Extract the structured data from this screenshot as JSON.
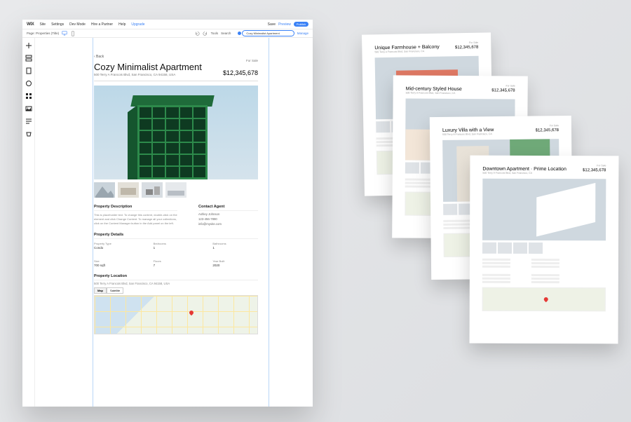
{
  "topbar": {
    "logo": "WIX",
    "menu": [
      "Site",
      "Settings",
      "Dev Mode",
      "Hire a Partner",
      "Help",
      "Upgrade"
    ],
    "right": {
      "save": "Save",
      "preview": "Preview",
      "publish": "Publish"
    }
  },
  "subbar": {
    "page_label": "Page: Properties (Title)",
    "tools": "Tools",
    "search": "Search",
    "chip": "Cozy Minimalist Apartment",
    "manage": "Manage"
  },
  "side_tools": [
    "add",
    "sections",
    "pages",
    "design",
    "apps",
    "media",
    "content",
    "store"
  ],
  "page": {
    "back": "‹ Back",
    "status": "For Sale",
    "title": "Cozy Minimalist Apartment",
    "address": "500 Terry A Francois Blvd, San Francisco, CA 94158, USA",
    "price": "$12,345,678",
    "thumbs_count": 4,
    "description": {
      "heading": "Property Description",
      "body": "This is placeholder text. To change this content, double-click on the element and click Change Content. To manage all your collections, click on the Content Manager button in the Add panel on the left."
    },
    "agent": {
      "heading": "Contact Agent",
      "name": "Ashley Johnson",
      "phone": "123-456-7890",
      "email": "info@mysite.com"
    },
    "details": {
      "heading": "Property Details",
      "items": [
        {
          "label": "Property Type",
          "value": "Condo"
        },
        {
          "label": "Bedrooms",
          "value": "1"
        },
        {
          "label": "Bathrooms",
          "value": "1"
        },
        {
          "label": "Size",
          "value": "700 sqft"
        },
        {
          "label": "Floors",
          "value": "7"
        },
        {
          "label": "Year Built",
          "value": "2020"
        }
      ]
    },
    "location": {
      "heading": "Property Location",
      "address": "500 Terry A Francois Blvd, San Francisco, CA 94158, USA",
      "controls": [
        "Map",
        "Satellite"
      ]
    }
  },
  "cards": [
    {
      "status": "For Sale",
      "title": "Unique Farmhouse + Balcony",
      "sub": "500 Terry A Francois Blvd, San Francisco, CA",
      "price": "$12,345,678"
    },
    {
      "status": "For Sale",
      "title": "Mid-century Styled House",
      "sub": "500 Terry A Francois Blvd, San Francisco, CA",
      "price": "$12,345,678"
    },
    {
      "status": "For Sale",
      "title": "Luxury Villa with a View",
      "sub": "500 Terry A Francois Blvd, San Francisco, CA",
      "price": "$12,345,678"
    },
    {
      "status": "For Sale",
      "title": "Downtown Apartment · Prime Location",
      "sub": "500 Terry A Francois Blvd, San Francisco, CA",
      "price": "$12,345,678"
    }
  ]
}
